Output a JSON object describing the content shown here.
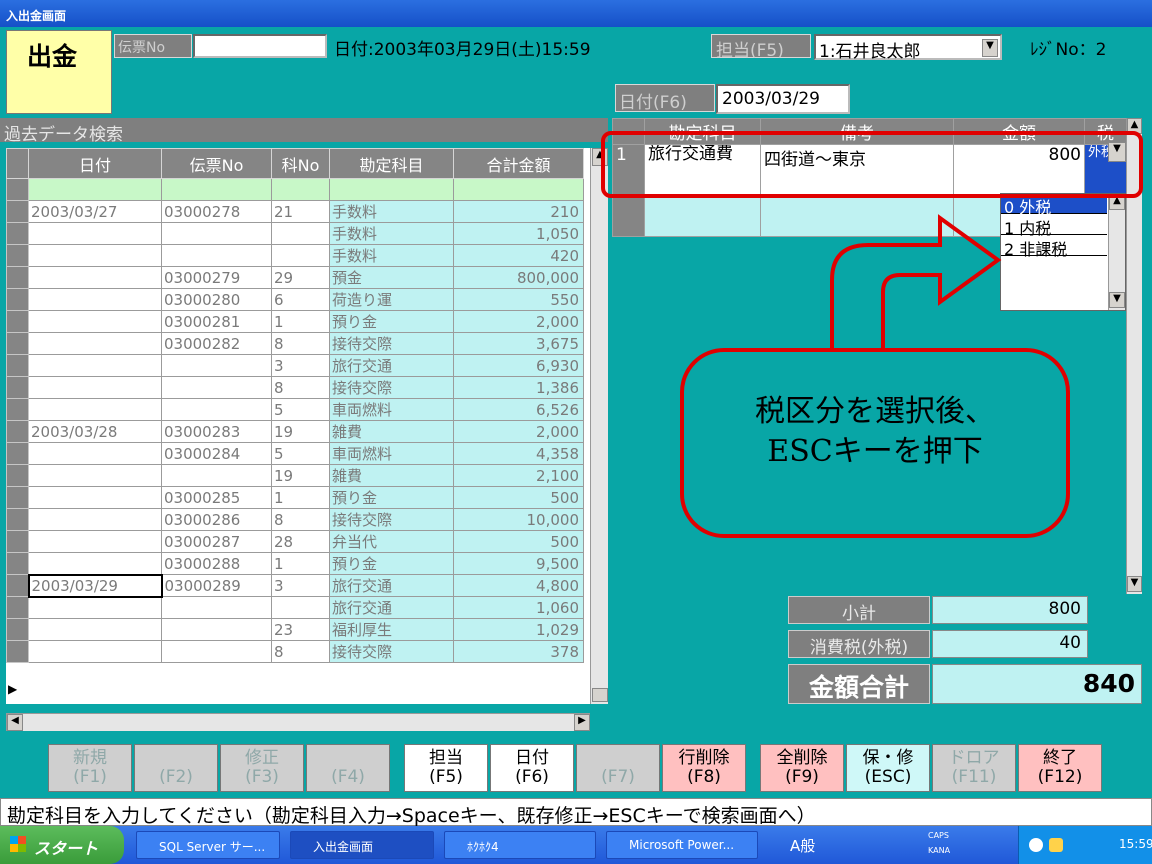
{
  "window": {
    "title": "入出金画面"
  },
  "header": {
    "mode": "出金",
    "slip_label": "伝票No",
    "date_text": "日付:2003年03月29日(土)15:59",
    "staff_label": "担当(F5)",
    "staff_value": "1:石井良太郎",
    "register_text": "ﾚｼﾞNo：2",
    "date_f6_label": "日付(F6)",
    "date_f6_value": "2003/03/29"
  },
  "search": {
    "title": "過去データ検索",
    "columns": [
      "日付",
      "伝票No",
      "科No",
      "勘定科目",
      "合計金額"
    ],
    "rows": [
      {
        "date": "2003/03/27",
        "slip": "03000278",
        "code": "21",
        "account": "手数料",
        "amount": "210"
      },
      {
        "date": "",
        "slip": "",
        "code": "",
        "account": "手数料",
        "amount": "1,050"
      },
      {
        "date": "",
        "slip": "",
        "code": "",
        "account": "手数料",
        "amount": "420"
      },
      {
        "date": "",
        "slip": "03000279",
        "code": "29",
        "account": "預金",
        "amount": "800,000"
      },
      {
        "date": "",
        "slip": "03000280",
        "code": "6",
        "account": "荷造り運",
        "amount": "550"
      },
      {
        "date": "",
        "slip": "03000281",
        "code": "1",
        "account": "預り金",
        "amount": "2,000"
      },
      {
        "date": "",
        "slip": "03000282",
        "code": "8",
        "account": "接待交際",
        "amount": "3,675"
      },
      {
        "date": "",
        "slip": "",
        "code": "3",
        "account": "旅行交通",
        "amount": "6,930"
      },
      {
        "date": "",
        "slip": "",
        "code": "8",
        "account": "接待交際",
        "amount": "1,386"
      },
      {
        "date": "",
        "slip": "",
        "code": "5",
        "account": "車両燃料",
        "amount": "6,526"
      },
      {
        "date": "2003/03/28",
        "slip": "03000283",
        "code": "19",
        "account": "雑費",
        "amount": "2,000"
      },
      {
        "date": "",
        "slip": "03000284",
        "code": "5",
        "account": "車両燃料",
        "amount": "4,358"
      },
      {
        "date": "",
        "slip": "",
        "code": "19",
        "account": "雑費",
        "amount": "2,100"
      },
      {
        "date": "",
        "slip": "03000285",
        "code": "1",
        "account": "預り金",
        "amount": "500"
      },
      {
        "date": "",
        "slip": "03000286",
        "code": "8",
        "account": "接待交際",
        "amount": "10,000"
      },
      {
        "date": "",
        "slip": "03000287",
        "code": "28",
        "account": "弁当代",
        "amount": "500"
      },
      {
        "date": "",
        "slip": "03000288",
        "code": "1",
        "account": "預り金",
        "amount": "9,500"
      },
      {
        "date": "2003/03/29",
        "slip": "03000289",
        "code": "3",
        "account": "旅行交通",
        "amount": "4,800"
      },
      {
        "date": "",
        "slip": "",
        "code": "",
        "account": "旅行交通",
        "amount": "1,060"
      },
      {
        "date": "",
        "slip": "",
        "code": "23",
        "account": "福利厚生",
        "amount": "1,029"
      },
      {
        "date": "",
        "slip": "",
        "code": "8",
        "account": "接待交際",
        "amount": "378"
      }
    ]
  },
  "entry": {
    "columns": [
      "勘定科目",
      "備考",
      "金額",
      "税"
    ],
    "row": {
      "no": "1",
      "account": "旅行交通費",
      "note": "四街道～東京",
      "amount": "800",
      "tax": "外税"
    },
    "tax_options": [
      "0 外税",
      "1 内税",
      "2 非課税"
    ]
  },
  "callout": {
    "line1": "税区分を選択後、",
    "line2": "ESCキーを押下"
  },
  "summary": {
    "subtotal_label": "小計",
    "subtotal": "800",
    "tax_label": "消費税(外税)",
    "tax": "40",
    "total_label": "金額合計",
    "total": "840"
  },
  "fkeys": [
    {
      "top": "新規",
      "bottom": "(F1)"
    },
    {
      "top": "",
      "bottom": "(F2)"
    },
    {
      "top": "修正",
      "bottom": "(F3)"
    },
    {
      "top": "",
      "bottom": "(F4)"
    },
    {
      "top": "担当",
      "bottom": "(F5)"
    },
    {
      "top": "日付",
      "bottom": "(F6)"
    },
    {
      "top": "",
      "bottom": "(F7)"
    },
    {
      "top": "行削除",
      "bottom": "(F8)"
    },
    {
      "top": "全削除",
      "bottom": "(F9)"
    },
    {
      "top": "保・修",
      "bottom": "(ESC)"
    },
    {
      "top": "ドロア",
      "bottom": "(F11)"
    },
    {
      "top": "終了",
      "bottom": "(F12)"
    }
  ],
  "status": "勘定科目を入力してください（勘定科目入力→Spaceキー、既存修正→ESCキーで検索画面へ）",
  "taskbar": {
    "start": "スタート",
    "items": [
      "SQL Server サー...",
      "入出金画面",
      "ﾎｸﾎｸ4",
      "Microsoft Power..."
    ],
    "ime": "A般",
    "caps": "CAPS",
    "kana": "KANA",
    "clock": "15:59"
  }
}
